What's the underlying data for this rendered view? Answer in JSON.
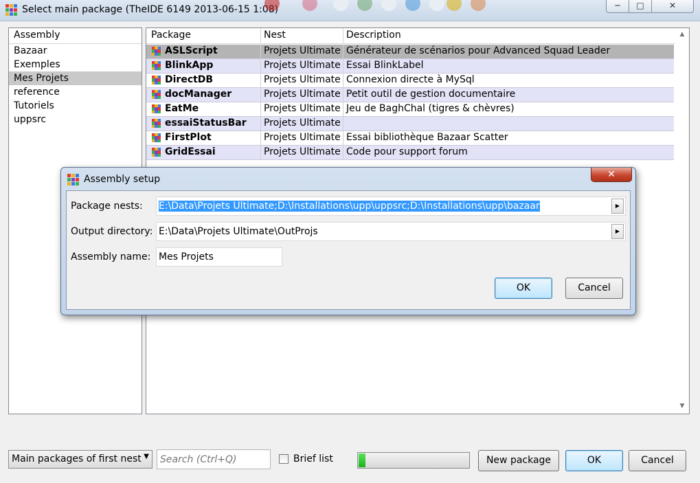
{
  "window": {
    "title": "Select main package (TheIDE 6149 2013-06-15 1:08)",
    "minimize_glyph": "─",
    "maximize_glyph": "□",
    "close_glyph": "✕"
  },
  "assemblies": {
    "header": "Assembly",
    "items": [
      "Bazaar",
      "Exemples",
      "Mes Projets",
      "reference",
      "Tutoriels",
      "uppsrc"
    ],
    "selected": "Mes Projets"
  },
  "packages": {
    "headers": {
      "package": "Package",
      "nest": "Nest",
      "description": "Description"
    },
    "rows": [
      {
        "name": "ASLScript",
        "nest": "Projets Ultimate",
        "description": "Générateur de scénarios pour Advanced Squad Leader"
      },
      {
        "name": "BlinkApp",
        "nest": "Projets Ultimate",
        "description": "Essai BlinkLabel"
      },
      {
        "name": "DirectDB",
        "nest": "Projets Ultimate",
        "description": "Connexion directe à MySql"
      },
      {
        "name": "docManager",
        "nest": "Projets Ultimate",
        "description": "Petit outil de gestion documentaire"
      },
      {
        "name": "EatMe",
        "nest": "Projets Ultimate",
        "description": "Jeu de BaghChal (tigres & chèvres)"
      },
      {
        "name": "essaiStatusBar",
        "nest": "Projets Ultimate",
        "description": ""
      },
      {
        "name": "FirstPlot",
        "nest": "Projets Ultimate",
        "description": "Essai bibliothèque Bazaar Scatter"
      },
      {
        "name": "GridEssai",
        "nest": "Projets Ultimate",
        "description": "Code pour support forum"
      }
    ]
  },
  "bottom": {
    "filter_select": "Main packages of first nest",
    "search_placeholder": "Search (Ctrl+Q)",
    "brief_list_label": "Brief list",
    "progress": 0.06,
    "new_package_label": "New package",
    "ok_label": "OK",
    "cancel_label": "Cancel"
  },
  "dialog": {
    "title": "Assembly setup",
    "close_glyph": "✕",
    "package_nests_label": "Package nests:",
    "package_nests_value": "E:\\Data\\Projets Ultimate;D:\\Installations\\upp\\uppsrc;D:\\Installations\\upp\\bazaar",
    "output_dir_label": "Output directory:",
    "output_dir_value": "E:\\Data\\Projets Ultimate\\OutProjs",
    "assembly_name_label": "Assembly name:",
    "assembly_name_value": "Mes Projets",
    "ok_label": "OK",
    "cancel_label": "Cancel"
  },
  "colors": {
    "selection_blue": "#3399ff",
    "row_alt": "#e3e3f8",
    "selected_row": "#b4b4b4",
    "progress_green": "#1bb31b",
    "dialog_close_red": "#c7462f"
  }
}
